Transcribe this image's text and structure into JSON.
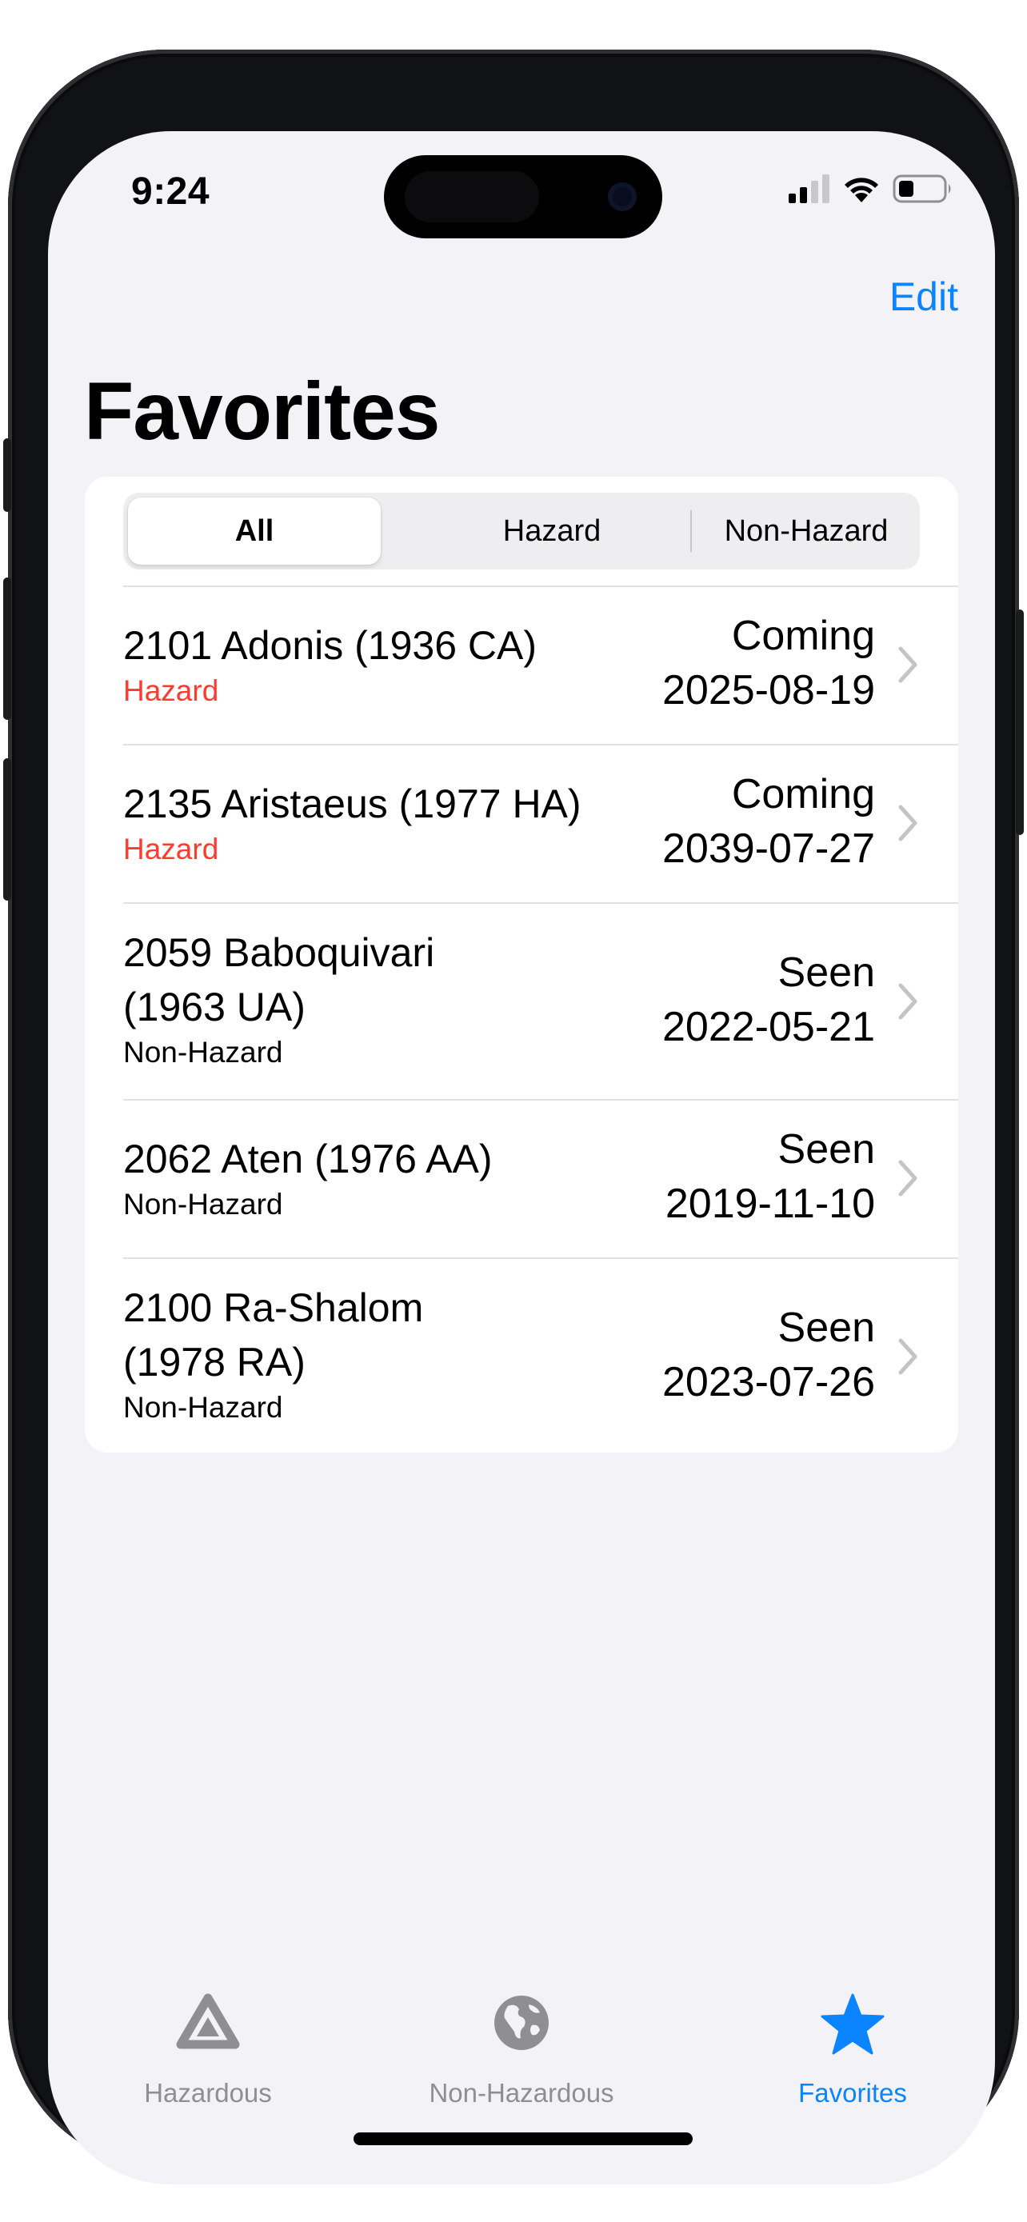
{
  "status_bar": {
    "time": "9:24"
  },
  "nav": {
    "edit_label": "Edit",
    "title": "Favorites"
  },
  "segmented": {
    "options": [
      "All",
      "Hazard",
      "Non-Hazard"
    ],
    "selected": "All"
  },
  "favorites": [
    {
      "name_lines": [
        "2101 Adonis (1936 CA)"
      ],
      "classification": "Hazard",
      "status": "Coming",
      "date": "2025-08-19"
    },
    {
      "name_lines": [
        "2135 Aristaeus (1977 HA)"
      ],
      "classification": "Hazard",
      "status": "Coming",
      "date": "2039-07-27"
    },
    {
      "name_lines": [
        "2059 Baboquivari",
        "(1963 UA)"
      ],
      "classification": "Non-Hazard",
      "status": "Seen",
      "date": "2022-05-21"
    },
    {
      "name_lines": [
        "2062 Aten (1976 AA)"
      ],
      "classification": "Non-Hazard",
      "status": "Seen",
      "date": "2019-11-10"
    },
    {
      "name_lines": [
        "2100 Ra-Shalom",
        "(1978 RA)"
      ],
      "classification": "Non-Hazard",
      "status": "Seen",
      "date": "2023-07-26"
    }
  ],
  "tab_bar": {
    "tabs": [
      {
        "label": "Hazardous",
        "icon": "hazard-triangle-icon",
        "active": false
      },
      {
        "label": "Non-Hazardous",
        "icon": "globe-icon",
        "active": false
      },
      {
        "label": "Favorites",
        "icon": "star-icon",
        "active": true
      }
    ]
  },
  "colors": {
    "accent": "#0a84ff",
    "hazard": "#ff3b30",
    "inactive": "#8e8e93",
    "background": "#f2f2f7"
  }
}
